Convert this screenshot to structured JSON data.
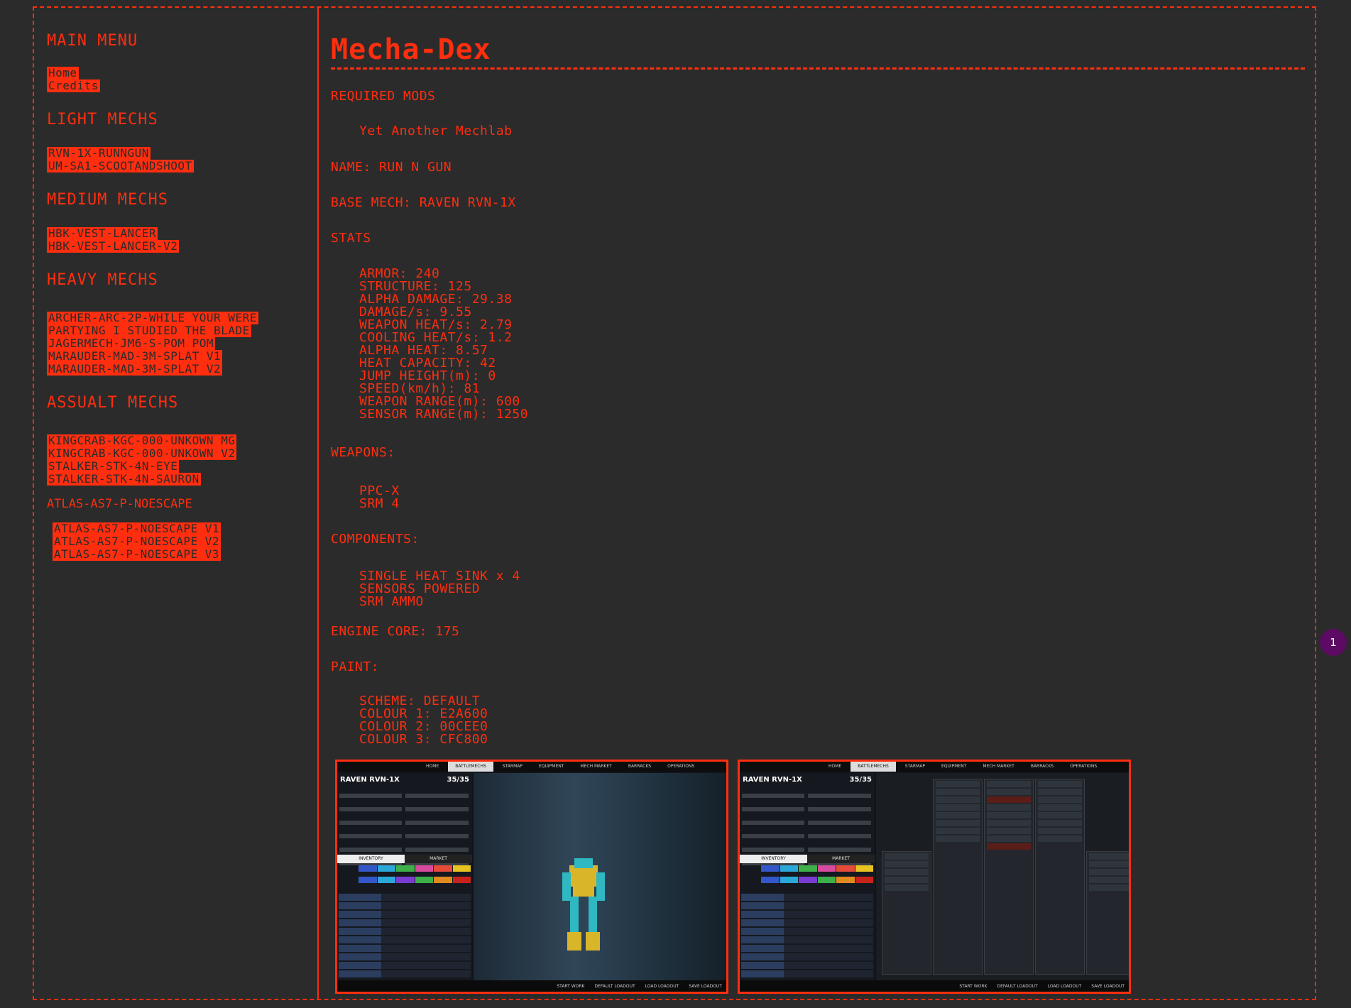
{
  "sidebar": {
    "main_menu_heading": "MAIN MENU",
    "main_links": [
      "Home",
      "Credits"
    ],
    "light_heading": "LIGHT MECHS",
    "light_links": [
      "RVN-1X-RUNNGUN",
      "UM-SA1-SCOOTANDSHOOT"
    ],
    "medium_heading": "MEDIUM MECHS",
    "medium_links": [
      "HBK-VEST-LANCER",
      "HBK-VEST-LANCER-V2"
    ],
    "heavy_heading": "HEAVY MECHS",
    "heavy_links": [
      "ARCHER-ARC-2P-WHILE YOUR WERE",
      "PARTYING I STUDIED THE BLADE",
      "JAGERMECH-JM6-S-POM POM",
      "MARAUDER-MAD-3M-SPLAT V1",
      "MARAUDER-MAD-3M-SPLAT V2"
    ],
    "assault_heading": "ASSUALT MECHS",
    "assault_links": [
      "KINGCRAB-KGC-000-UNKOWN MG",
      "KINGCRAB-KGC-000-UNKOWN V2",
      "STALKER-STK-4N-EYE",
      "STALKER-STK-4N-SAURON"
    ],
    "atlas_heading": "ATLAS-AS7-P-NOESCAPE",
    "atlas_links": [
      "ATLAS-AS7-P-NOESCAPE V1",
      "ATLAS-AS7-P-NOESCAPE V2",
      "ATLAS-AS7-P-NOESCAPE V3"
    ]
  },
  "main": {
    "title": "Mecha-Dex",
    "required_mods_label": "REQUIRED MODS",
    "required_mods": [
      "Yet Another Mechlab"
    ],
    "name_line": "NAME: RUN N GUN",
    "base_mech_line": "BASE MECH: RAVEN RVN-1X",
    "stats_label": "STATS",
    "stats": [
      "ARMOR: 240",
      "STRUCTURE: 125",
      "ALPHA DAMAGE: 29.38",
      "DAMAGE/s: 9.55",
      "WEAPON HEAT/s: 2.79",
      "COOLING HEAT/s: 1.2",
      "ALPHA HEAT: 8.57",
      "HEAT CAPACITY: 42",
      "JUMP HEIGHT(m): 0",
      "SPEED(km/h): 81",
      "WEAPON RANGE(m): 600",
      "SENSOR RANGE(m): 1250"
    ],
    "weapons_label": "WEAPONS:",
    "weapons": [
      "PPC-X",
      "SRM 4"
    ],
    "components_label": "COMPONENTS:",
    "components": [
      "SINGLE HEAT SINK x 4",
      "SENSORS POWERED",
      "SRM AMMO"
    ],
    "engine_line": "ENGINE CORE: 175",
    "paint_label": "PAINT:",
    "paint": [
      "SCHEME: DEFAULT",
      "COLOUR 1: E2A600",
      "COLOUR 2: 00CEE0",
      "COLOUR 3: CFC800"
    ]
  },
  "screenshots": [
    {
      "tabs": [
        "HOME",
        "BATTLEMECHS",
        "STARMAP",
        "EQUIPMENT",
        "MECH MARKET",
        "BARRACKS",
        "OPERATIONS"
      ],
      "mech_name": "RAVEN RVN-1X",
      "tonnage": "35/35",
      "inventory_tab": "INVENTORY",
      "market_tab": "MARKET",
      "bottom_actions": [
        "START WORK",
        "DEFAULT LOADOUT",
        "LOAD LOADOUT",
        "SAVE LOADOUT"
      ]
    },
    {
      "tabs": [
        "HOME",
        "BATTLEMECHS",
        "STARMAP",
        "EQUIPMENT",
        "MECH MARKET",
        "BARRACKS",
        "OPERATIONS"
      ],
      "mech_name": "RAVEN RVN-1X",
      "tonnage": "35/35",
      "inventory_tab": "INVENTORY",
      "market_tab": "MARKET",
      "bottom_actions": [
        "START WORK",
        "DEFAULT LOADOUT",
        "LOAD LOADOUT",
        "SAVE LOADOUT"
      ]
    }
  ],
  "badge": {
    "count": "1"
  },
  "colors": {
    "accent": "#ff2e0f",
    "background": "#2b2b2b",
    "badge": "#5c0a63"
  }
}
